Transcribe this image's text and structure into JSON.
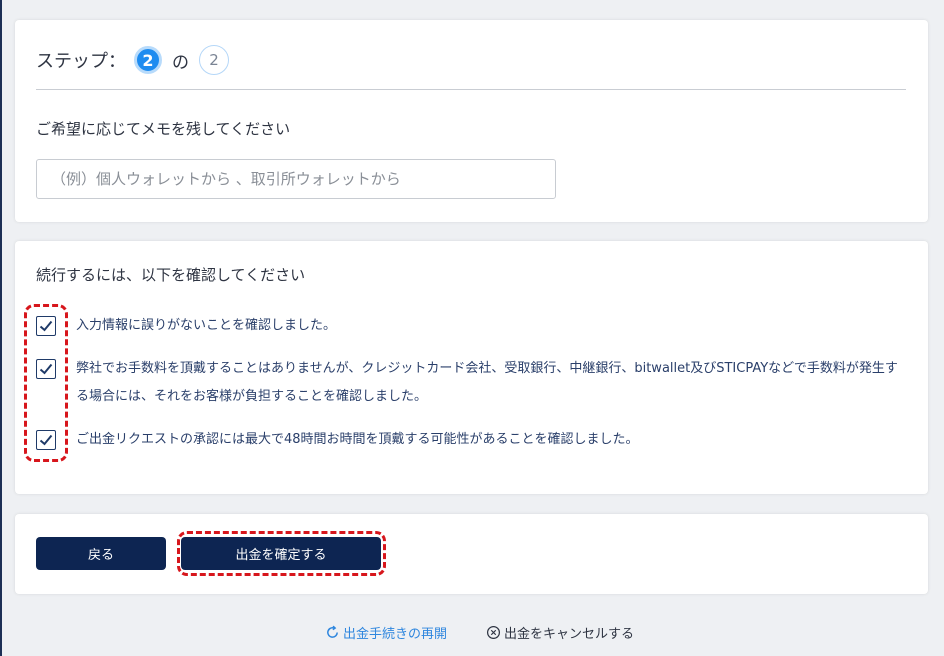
{
  "step": {
    "label": "ステップ：",
    "current": "2",
    "of": "の",
    "total": "2"
  },
  "memo": {
    "label": "ご希望に応じてメモを残してください",
    "placeholder": "（例）個人ウォレットから 、取引所ウォレットから",
    "value": ""
  },
  "confirm": {
    "title": "続行するには、以下を確認してください",
    "items": [
      {
        "text": "入力情報に誤りがないことを確認しました。",
        "checked": true
      },
      {
        "text": "弊社でお手数料を頂戴することはありませんが、クレジットカード会社、受取銀行、中継銀行、bitwallet及びSTICPAYなどで手数料が発生する場合には、それをお客様が負担することを確認しました。",
        "checked": true
      },
      {
        "text": "ご出金リクエストの承認には最大で48時間お時間を頂戴する可能性があることを確認しました。",
        "checked": true
      }
    ]
  },
  "buttons": {
    "back": "戻る",
    "confirm": "出金を確定する"
  },
  "footer": {
    "resume": "出金手続きの再開",
    "cancel": "出金をキャンセルする"
  },
  "colors": {
    "primary": "#0d2552",
    "step_active": "#1e8cf0",
    "highlight": "#d7161c",
    "link": "#2e86de"
  }
}
